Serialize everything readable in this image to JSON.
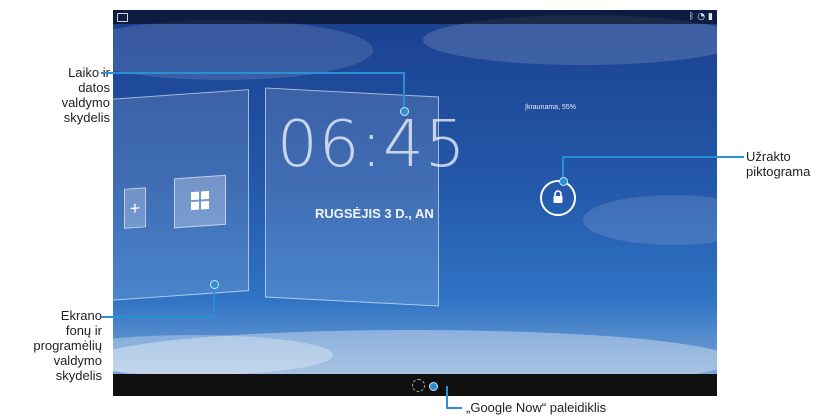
{
  "tablet": {
    "clock_time": "06:45",
    "clock_date": "RUGSĖJIS 3 D., AN",
    "charging_status": "Įkraunama, 55%",
    "lock_icon": "lock-icon",
    "google_now_icon": "google-now-launcher-icon",
    "status_icons": [
      "picture-icon",
      "bluetooth-icon",
      "wifi-icon",
      "battery-icon"
    ],
    "colors": {
      "wallpaper_top": "#1b3f8f",
      "wallpaper_bottom": "#8fb2d9",
      "callout": "#2a8fd6"
    }
  },
  "callouts": {
    "clock_widget": [
      "Laiko ir",
      "datos",
      "valdymo",
      "skydelis"
    ],
    "wallpaper_apps": [
      "Ekrano",
      "fonų ir",
      "programėlių",
      "valdymo",
      "skydelis"
    ],
    "lock_icon": [
      "Užrakto",
      "piktograma"
    ],
    "google_now": "„Google Now“ paleidiklis"
  }
}
